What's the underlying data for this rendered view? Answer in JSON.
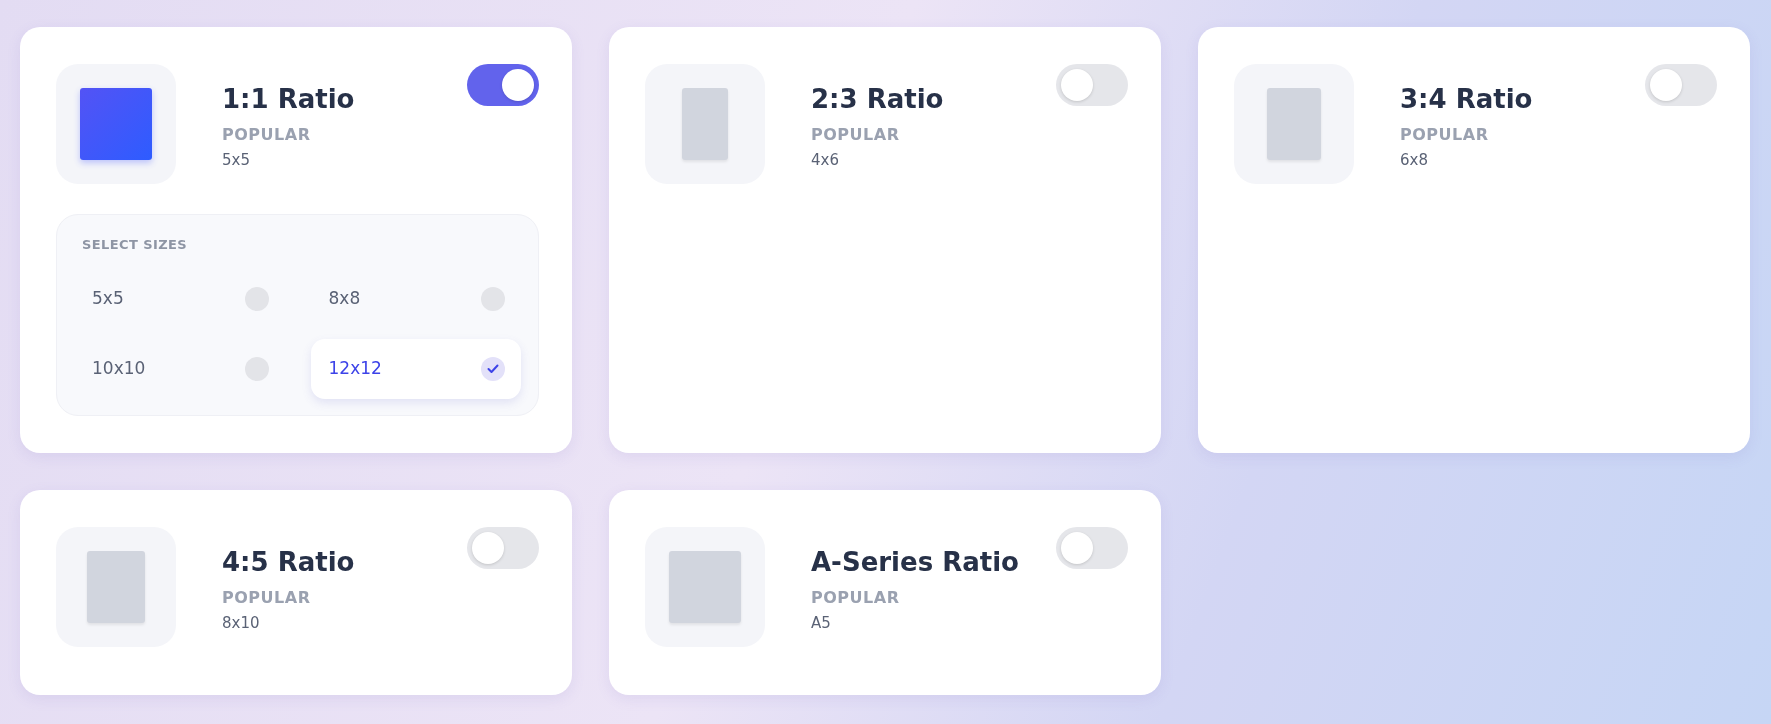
{
  "ratios": [
    {
      "title": "1:1 Ratio",
      "tag": "POPULAR",
      "default_size": "5x5",
      "kind": "square",
      "on": true,
      "sizes_label": "SELECT SIZES",
      "sizes": [
        {
          "label": "5x5",
          "selected": false
        },
        {
          "label": "8x8",
          "selected": false
        },
        {
          "label": "10x10",
          "selected": false
        },
        {
          "label": "12x12",
          "selected": true
        }
      ]
    },
    {
      "title": "2:3 Ratio",
      "tag": "POPULAR",
      "default_size": "4x6",
      "kind": "narrow",
      "on": false
    },
    {
      "title": "3:4 Ratio",
      "tag": "POPULAR",
      "default_size": "6x8",
      "kind": "medium",
      "on": false
    },
    {
      "title": "4:5 Ratio",
      "tag": "POPULAR",
      "default_size": "8x10",
      "kind": "broad",
      "on": false
    },
    {
      "title": "A-Series Ratio",
      "tag": "POPULAR",
      "default_size": "A5",
      "kind": "squarish",
      "on": false
    }
  ]
}
